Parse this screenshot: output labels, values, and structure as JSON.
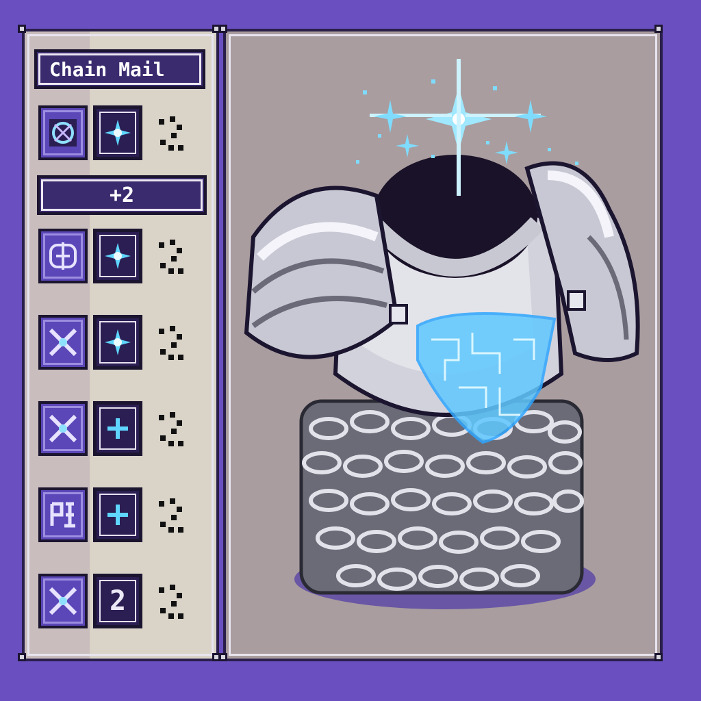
{
  "item": {
    "name": "Chain Mail",
    "level_label": "+2"
  },
  "runes": [
    {
      "rune_icon": "ornate-rune-icon",
      "value_icon": "sparkle-icon",
      "value_text": ""
    },
    {
      "rune_icon": "knot-rune-icon",
      "value_icon": "sparkle-icon",
      "value_text": ""
    },
    {
      "rune_icon": "cross-rune-icon",
      "value_icon": "sparkle-icon",
      "value_text": ""
    },
    {
      "rune_icon": "cross-rune-icon",
      "value_icon": "plus-icon",
      "value_text": ""
    },
    {
      "rune_icon": "glyph-rune-icon",
      "value_icon": "plus-icon",
      "value_text": ""
    },
    {
      "rune_icon": "cross-rune-icon",
      "value_icon": "",
      "value_text": "2"
    }
  ],
  "colors": {
    "background": "#6a4fc0",
    "panel_dark": "#3a2a6e",
    "glow": "#5fd6ff",
    "steel": "#c8c8d2"
  }
}
